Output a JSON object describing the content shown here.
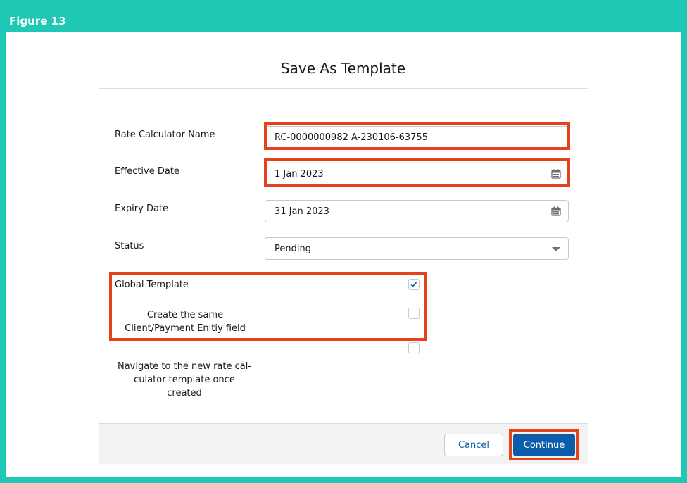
{
  "figure_label": "Figure 13",
  "dialog": {
    "title": "Save As Template"
  },
  "form": {
    "rate_calculator_name": {
      "label": "Rate Calculator Name",
      "value": "RC-0000000982 A-230106-63755"
    },
    "effective_date": {
      "label": "Effective Date",
      "value": "1 Jan 2023",
      "icon": "calendar-icon"
    },
    "expiry_date": {
      "label": "Expiry Date",
      "value": "31 Jan 2023",
      "icon": "calendar-icon"
    },
    "status": {
      "label": "Status",
      "value": "Pending",
      "icon": "dropdown-arrow-icon"
    },
    "global_template": {
      "label": "Global Template",
      "checked": true
    },
    "create_same": {
      "label_line1": "Create the same",
      "label_line2": "Client/Payment Enitiy field",
      "checked": false
    },
    "navigate": {
      "label_line1": "Navigate to the new rate cal-",
      "label_line2": "culator template once",
      "label_line3": "created",
      "checked": false
    }
  },
  "footer": {
    "cancel_label": "Cancel",
    "continue_label": "Continue"
  },
  "colors": {
    "frame": "#1ec8b4",
    "highlight": "#e2421c",
    "primary": "#0b5cab"
  }
}
